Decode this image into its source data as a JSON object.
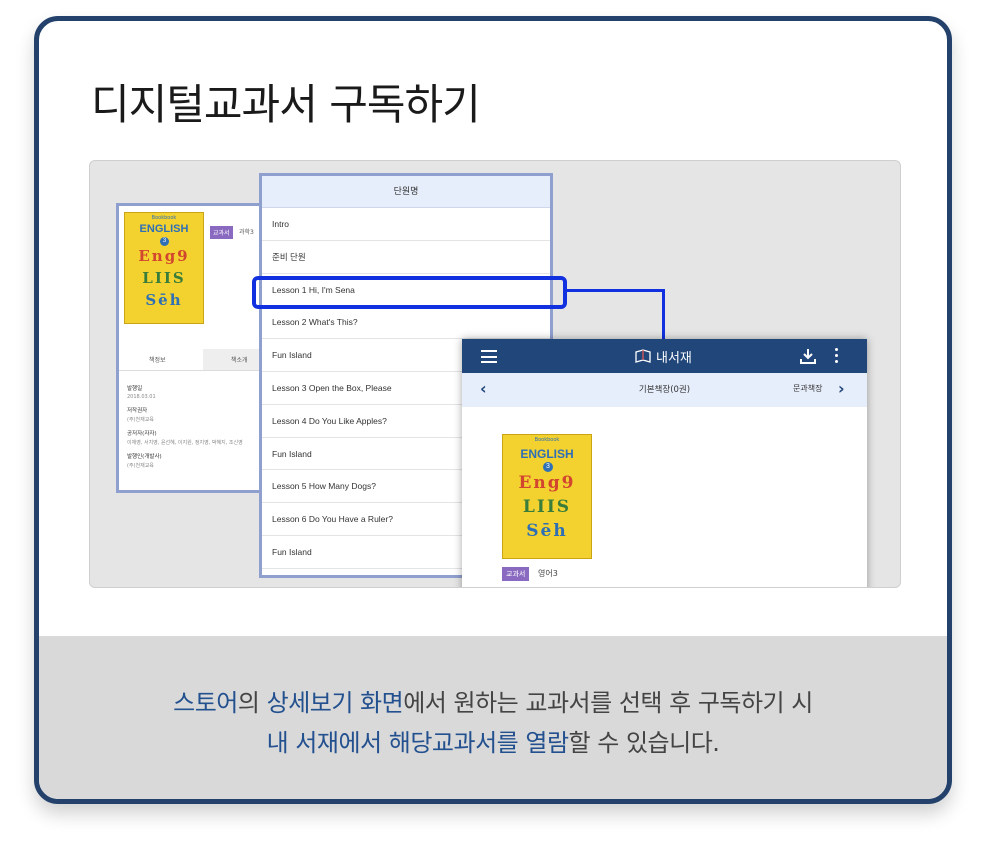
{
  "title": "디지털교과서 구독하기",
  "detail_panel": {
    "cover": {
      "publisher": "Bookbook",
      "title": "ENGLISH",
      "grade": "3",
      "art_lines": [
        "Eng9",
        "LIIS",
        "Sēh"
      ]
    },
    "badge": "교과서",
    "badge_name": "과학3",
    "tabs": [
      "책정보",
      "책소개"
    ],
    "info": [
      {
        "label": "발행일",
        "value": "2018.03.01"
      },
      {
        "label": "저작권자",
        "value": "(주)천재교육"
      },
      {
        "label": "공저자(자자)",
        "value": "이재영, 서지영, 윤선혜, 이지원, 정지영, 박혜지, 조신영"
      },
      {
        "label": "발행인(개발사)",
        "value": "(주)천재교육"
      }
    ]
  },
  "unit_list": {
    "header": "단원명",
    "items": [
      "Intro",
      "준비 단원",
      "Lesson 1 Hi, I'm Sena",
      "Lesson 2 What's This?",
      "Fun Island",
      "Lesson 3 Open the Box, Please",
      "Lesson 4 Do You Like Apples?",
      "Fun Island",
      "Lesson 5 How Many Dogs?",
      "Lesson 6 Do You Have a Ruler?",
      "Fun Island"
    ],
    "highlighted_index": 2
  },
  "library": {
    "app_title": "내서재",
    "shelf_title": "기본책장(0권)",
    "shelf_next": "문과책장",
    "book_badge": "교과서",
    "book_name": "영어3"
  },
  "footer": {
    "line1": [
      {
        "text": "스토어",
        "hl": true
      },
      {
        "text": "의 ",
        "hl": false
      },
      {
        "text": "상세보기 화면",
        "hl": true
      },
      {
        "text": "에서 원하는 교과서를 선택 후 구독하기 시",
        "hl": false
      }
    ],
    "line2": [
      {
        "text": "내 서재에서 해당교과서를 열람",
        "hl": true
      },
      {
        "text": "할 수 있습니다.",
        "hl": false
      }
    ]
  },
  "colors": {
    "frame": "#23416b",
    "highlight": "#1131e0",
    "app_bar": "#21467a",
    "accent_text": "#23508f",
    "badge": "#8a6ac0"
  }
}
